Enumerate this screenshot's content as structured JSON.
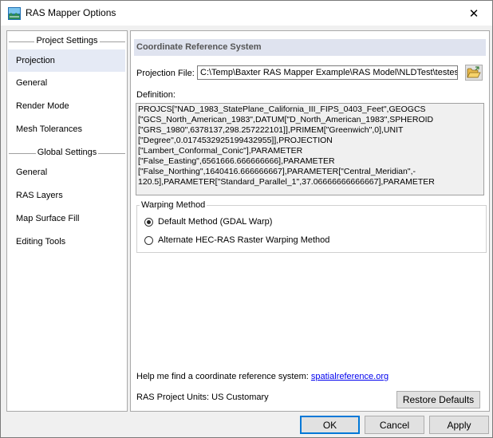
{
  "window": {
    "title": "RAS Mapper Options"
  },
  "sidebar": {
    "project_header": "Project Settings",
    "project_items": [
      {
        "label": "Projection"
      },
      {
        "label": "General"
      },
      {
        "label": "Render Mode"
      },
      {
        "label": "Mesh Tolerances"
      }
    ],
    "global_header": "Global Settings",
    "global_items": [
      {
        "label": "General"
      },
      {
        "label": "RAS Layers"
      },
      {
        "label": "Map Surface Fill"
      },
      {
        "label": "Editing Tools"
      }
    ]
  },
  "panel": {
    "section_title": "Coordinate Reference System",
    "projection_file_label": "Projection File:",
    "projection_file_value": "C:\\Temp\\Baxter RAS Mapper Example\\RAS Model\\NLDTest\\testes",
    "definition_label": "Definition:",
    "definition_text": "PROJCS[\"NAD_1983_StatePlane_California_III_FIPS_0403_Feet\",GEOGCS\n[\"GCS_North_American_1983\",DATUM[\"D_North_American_1983\",SPHEROID\n[\"GRS_1980\",6378137,298.257222101]],PRIMEM[\"Greenwich\",0],UNIT\n[\"Degree\",0.0174532925199432955]],PROJECTION\n[\"Lambert_Conformal_Conic\"],PARAMETER\n[\"False_Easting\",6561666.666666666],PARAMETER\n[\"False_Northing\",1640416.666666667],PARAMETER[\"Central_Meridian\",-\n120.5],PARAMETER[\"Standard_Parallel_1\",37.06666666666667],PARAMETER",
    "warping": {
      "legend": "Warping Method",
      "options": [
        {
          "label": "Default Method (GDAL Warp)",
          "selected": true
        },
        {
          "label": "Alternate HEC-RAS Raster Warping Method",
          "selected": false
        }
      ]
    },
    "help_text": "Help me find a coordinate reference system:",
    "help_link": "spatialreference.org",
    "units_text": "RAS Project Units: US Customary",
    "restore_label": "Restore Defaults"
  },
  "footer": {
    "ok_label": "OK",
    "cancel_label": "Cancel",
    "apply_label": "Apply"
  },
  "colors": {
    "selected_item": "#e5eaf5",
    "section_header": "#dfe3ef",
    "link": "#0000ee",
    "default_button_border": "#0078d7"
  }
}
